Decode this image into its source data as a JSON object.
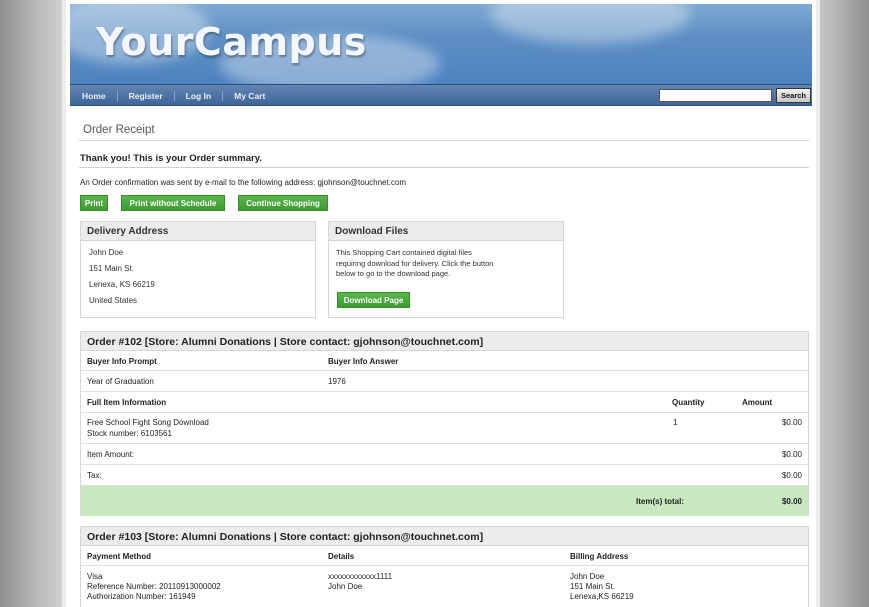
{
  "header": {
    "logo": "YourCampus"
  },
  "nav": {
    "items": [
      "Home",
      "Register",
      "Log In",
      "My Cart"
    ],
    "search_button": "Search",
    "search_value": ""
  },
  "page_title": "Order Receipt",
  "thank_you": "Thank you! This is your Order summary.",
  "confirmation": "An Order confirmation was sent by e-mail to the following address: gjohnson@touchnet.com",
  "buttons": {
    "print": "Print",
    "print_no_schedule": "Print without Schedule",
    "continue": "Continue Shopping"
  },
  "delivery": {
    "title": "Delivery Address",
    "lines": [
      "John Doe",
      "151 Main St.",
      "Lenexa, KS 66219",
      "United States"
    ]
  },
  "download": {
    "title": "Download Files",
    "text": [
      "This Shopping Cart contained digital files",
      "requiring download for delivery. Click the button",
      "below to go to the download page."
    ],
    "button": "Download Page"
  },
  "order1": {
    "title": "Order #102 [Store: Alumni Donations | Store contact: gjohnson@touchnet.com]",
    "buyer_prompt_header": "Buyer Info Prompt",
    "buyer_answer_header": "Buyer Info Answer",
    "prompt": "Year of Graduation",
    "answer": "1976",
    "item_header": "Full Item Information",
    "qty_header": "Quantity",
    "amount_header": "Amount",
    "item_name": "Free School Fight Song Download",
    "item_stock": "Stock number: 6103561",
    "item_qty": "1",
    "item_amount": "$0.00",
    "item_amount_label": "Item Amount:",
    "item_amount_value": "$0.00",
    "tax_label": "Tax:",
    "tax_value": "$0.00",
    "total_label": "Item(s) total:",
    "total_value": "$0.00"
  },
  "order2": {
    "title": "Order #103 [Store: Alumni Donations | Store contact: gjohnson@touchnet.com]",
    "payment_header": "Payment Method",
    "details_header": "Details",
    "billing_header": "Billing Address",
    "payment": [
      "Visa",
      "Reference Number: 20110913000002",
      "Authorization Number: 161949"
    ],
    "details": [
      "xxxxxxxxxxxx1111",
      "John Doe"
    ],
    "billing": [
      "John Doe",
      "151 Main St.",
      "Lenexa,KS 66219"
    ]
  }
}
